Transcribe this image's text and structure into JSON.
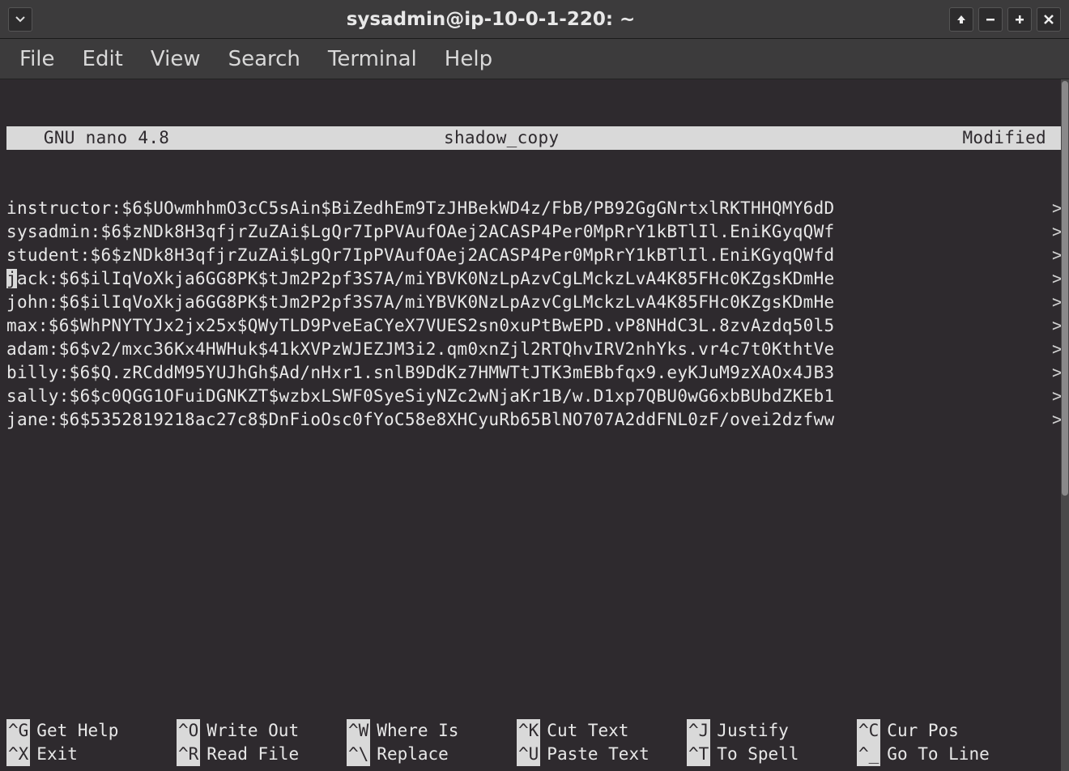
{
  "window": {
    "title": "sysadmin@ip-10-0-1-220: ~"
  },
  "menubar": {
    "items": [
      "File",
      "Edit",
      "View",
      "Search",
      "Terminal",
      "Help"
    ]
  },
  "nano": {
    "version_label": "  GNU nano 4.8",
    "filename": "shadow_copy",
    "modified_label": "Modified",
    "cursor": {
      "line": 3,
      "col": 0
    },
    "lines": [
      "instructor:$6$UOwmhhmO3cC5sAin$BiZedhEm9TzJHBekWD4z/FbB/PB92GgGNrtxlRKTHHQMY6dD",
      "sysadmin:$6$zNDk8H3qfjrZuZAi$LgQr7IpPVAufOAej2ACASP4Per0MpRrY1kBTlIl.EniKGyqQWf",
      "student:$6$zNDk8H3qfjrZuZAi$LgQr7IpPVAufOAej2ACASP4Per0MpRrY1kBTlIl.EniKGyqQWfd",
      "jack:$6$ilIqVoXkja6GG8PK$tJm2P2pf3S7A/miYBVK0NzLpAzvCgLMckzLvA4K85FHc0KZgsKDmHe",
      "john:$6$ilIqVoXkja6GG8PK$tJm2P2pf3S7A/miYBVK0NzLpAzvCgLMckzLvA4K85FHc0KZgsKDmHe",
      "max:$6$WhPNYTYJx2jx25x$QWyTLD9PveEaCYeX7VUES2sn0xuPtBwEPD.vP8NHdC3L.8zvAzdq50l5",
      "adam:$6$v2/mxc36Kx4HWHuk$41kXVPzWJEZJM3i2.qm0xnZjl2RTQhvIRV2nhYks.vr4c7t0KthtVe",
      "billy:$6$Q.zRCddM95YUJhGh$Ad/nHxr1.snlB9DdKz7HMWTtJTK3mEBbfqx9.eyKJuM9zXAOx4JB3",
      "sally:$6$c0QGG1OFuiDGNKZT$wzbxLSWF0SyeSiyNZc2wNjaKr1B/w.D1xp7QBU0wG6xbBUbdZKEb1",
      "jane:$6$5352819218ac27c8$DnFioOsc0fYoC58e8XHCyuRb65BlNO707A2ddFNL0zF/ovei2dzfww"
    ],
    "continuation_char": ">",
    "shortcuts": [
      [
        {
          "key": "^G",
          "label": "Get Help"
        },
        {
          "key": "^O",
          "label": "Write Out"
        },
        {
          "key": "^W",
          "label": "Where Is"
        },
        {
          "key": "^K",
          "label": "Cut Text"
        },
        {
          "key": "^J",
          "label": "Justify"
        },
        {
          "key": "^C",
          "label": "Cur Pos"
        }
      ],
      [
        {
          "key": "^X",
          "label": "Exit"
        },
        {
          "key": "^R",
          "label": "Read File"
        },
        {
          "key": "^\\",
          "label": "Replace"
        },
        {
          "key": "^U",
          "label": "Paste Text"
        },
        {
          "key": "^T",
          "label": "To Spell"
        },
        {
          "key": "^_",
          "label": "Go To Line"
        }
      ]
    ]
  }
}
